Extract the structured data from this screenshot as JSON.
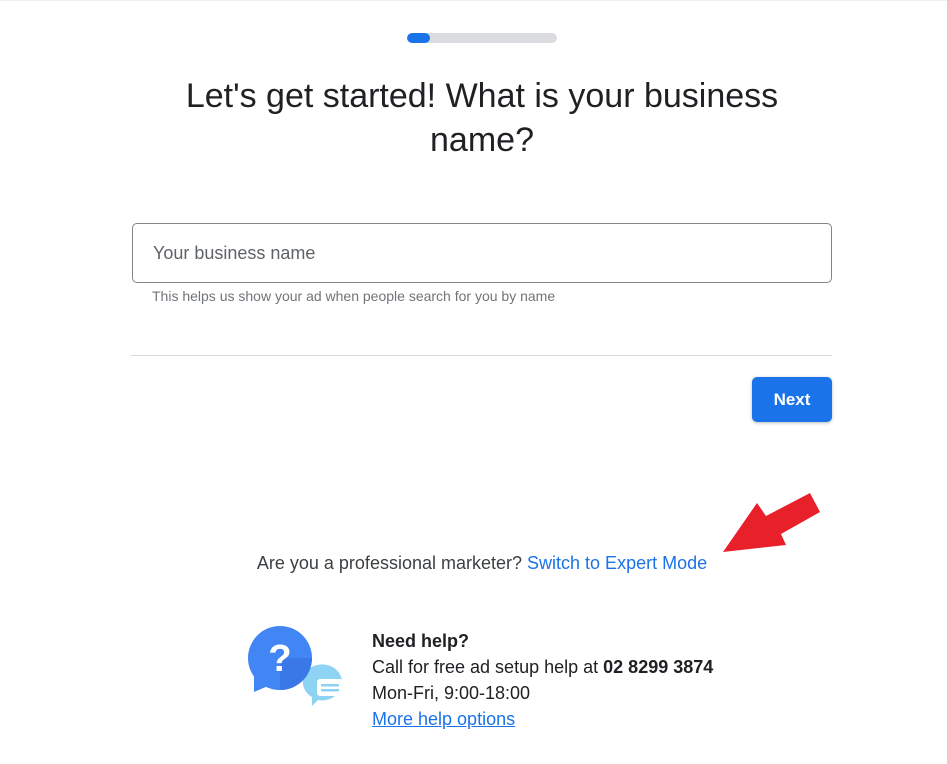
{
  "progress": {
    "fraction": 0.15,
    "track_color": "#dadce0",
    "fill_color": "#1a73e8"
  },
  "header": {
    "title": "Let's get started! What is your business name?"
  },
  "form": {
    "business_name_placeholder": "Your business name",
    "business_name_value": "",
    "helper_text": "This helps us show your ad when people search for you by name",
    "next_label": "Next"
  },
  "expert": {
    "prompt": "Are you a professional marketer?",
    "link_label": "Switch to Expert Mode"
  },
  "help": {
    "icon": "help-chat-icon",
    "title": "Need help?",
    "call_prefix": "Call for free ad setup help at",
    "phone": "02 8299 3874",
    "hours": "Mon-Fri, 9:00-18:00",
    "more_link": "More help options"
  },
  "annotation": {
    "icon": "red-arrow-icon",
    "color": "#e8202a"
  },
  "colors": {
    "accent": "#1a73e8",
    "text": "#202124",
    "muted": "#70757a"
  }
}
